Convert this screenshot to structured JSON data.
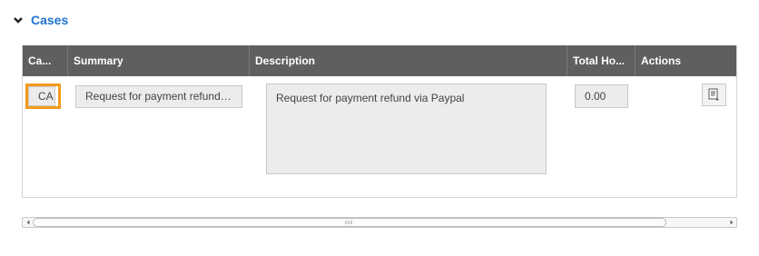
{
  "section": {
    "title": "Cases",
    "toggle_icon": "chevron-down-icon"
  },
  "grid": {
    "columns": [
      {
        "label": "Case Number",
        "display": "Ca..."
      },
      {
        "label": "Summary",
        "display": "Summary"
      },
      {
        "label": "Description",
        "display": "Description"
      },
      {
        "label": "Total Hours",
        "display": "Total Ho..."
      },
      {
        "label": "Actions",
        "display": "Actions"
      }
    ],
    "rows": [
      {
        "case_number": "CA",
        "summary": "Request for payment refund via Paypal",
        "description": "Request for payment refund via Paypal",
        "total_hours": "0.00",
        "action_icon": "edit-record-icon"
      }
    ]
  },
  "colors": {
    "accent": "#1f74d2",
    "focus": "#f39a1d",
    "header_bg": "#5f5f5f"
  }
}
